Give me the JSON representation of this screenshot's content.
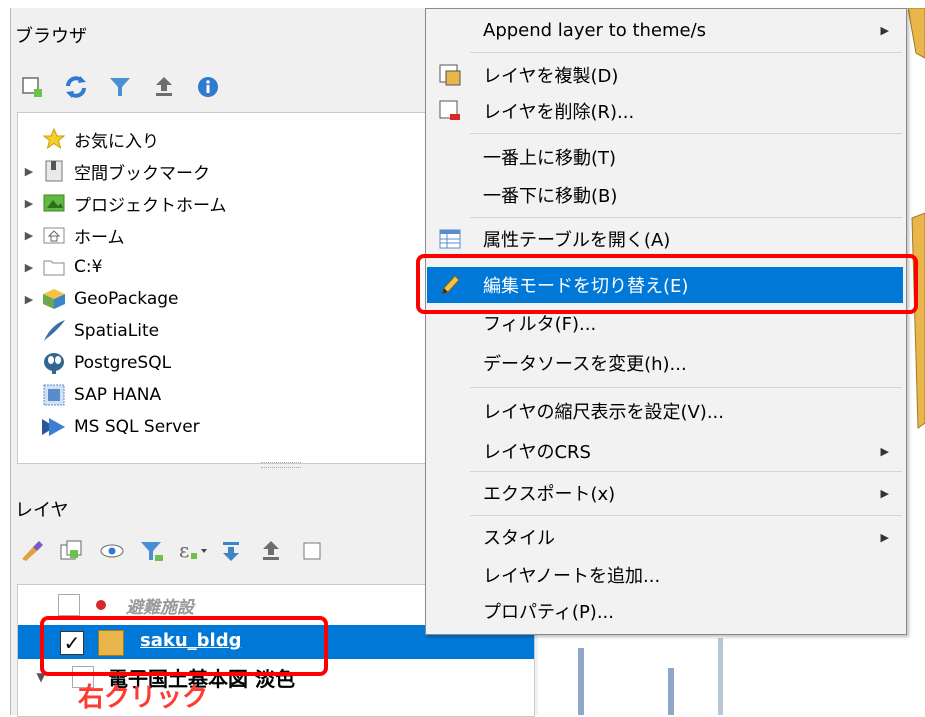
{
  "browser": {
    "title": "ブラウザ",
    "items": [
      {
        "label": "お気に入り",
        "icon": "star-icon",
        "expandable": false
      },
      {
        "label": "空間ブックマーク",
        "icon": "bookmark-icon",
        "expandable": true
      },
      {
        "label": "プロジェクトホーム",
        "icon": "project-home-icon",
        "expandable": true
      },
      {
        "label": "ホーム",
        "icon": "home-folder-icon",
        "expandable": true
      },
      {
        "label": "C:¥",
        "icon": "folder-icon",
        "expandable": true
      },
      {
        "label": "GeoPackage",
        "icon": "geopackage-icon",
        "expandable": true
      },
      {
        "label": "SpatiaLite",
        "icon": "spatialite-icon",
        "expandable": false
      },
      {
        "label": "PostgreSQL",
        "icon": "postgresql-icon",
        "expandable": false
      },
      {
        "label": "SAP HANA",
        "icon": "sap-hana-icon",
        "expandable": false
      },
      {
        "label": "MS SQL Server",
        "icon": "mssql-icon",
        "expandable": false
      }
    ]
  },
  "layers": {
    "title": "レイヤ",
    "rows": [
      {
        "label": "避難施設",
        "checked": false
      },
      {
        "label": "saku_bldg",
        "checked": true,
        "selected": true
      },
      {
        "label": "電子国土基本図 淡色",
        "checked": false
      }
    ]
  },
  "context_menu": {
    "items": [
      {
        "label": "Append layer to theme/s",
        "submenu": true
      },
      {
        "label": "レイヤを複製(D)",
        "icon": "duplicate-layer-icon"
      },
      {
        "label": "レイヤを削除(R)...",
        "icon": "remove-layer-icon"
      },
      {
        "label": "一番上に移動(T)"
      },
      {
        "label": "一番下に移動(B)"
      },
      {
        "label": "属性テーブルを開く(A)",
        "icon": "attribute-table-icon"
      },
      {
        "label": "編集モードを切り替え(E)",
        "icon": "pencil-icon",
        "active": true
      },
      {
        "label": "フィルタ(F)..."
      },
      {
        "label": "データソースを変更(h)..."
      },
      {
        "label": "レイヤの縮尺表示を設定(V)..."
      },
      {
        "label": "レイヤのCRS",
        "submenu": true
      },
      {
        "label": "エクスポート(x)",
        "submenu": true
      },
      {
        "label": "スタイル",
        "submenu": true
      },
      {
        "label": "レイヤノートを追加..."
      },
      {
        "label": "プロパティ(P)..."
      }
    ]
  },
  "annotation": {
    "label": "右クリック",
    "color": "#ff3b30"
  },
  "colors": {
    "highlight": "#0078d7",
    "callout": "#ff0000",
    "map_feature": "#e8b64a"
  }
}
